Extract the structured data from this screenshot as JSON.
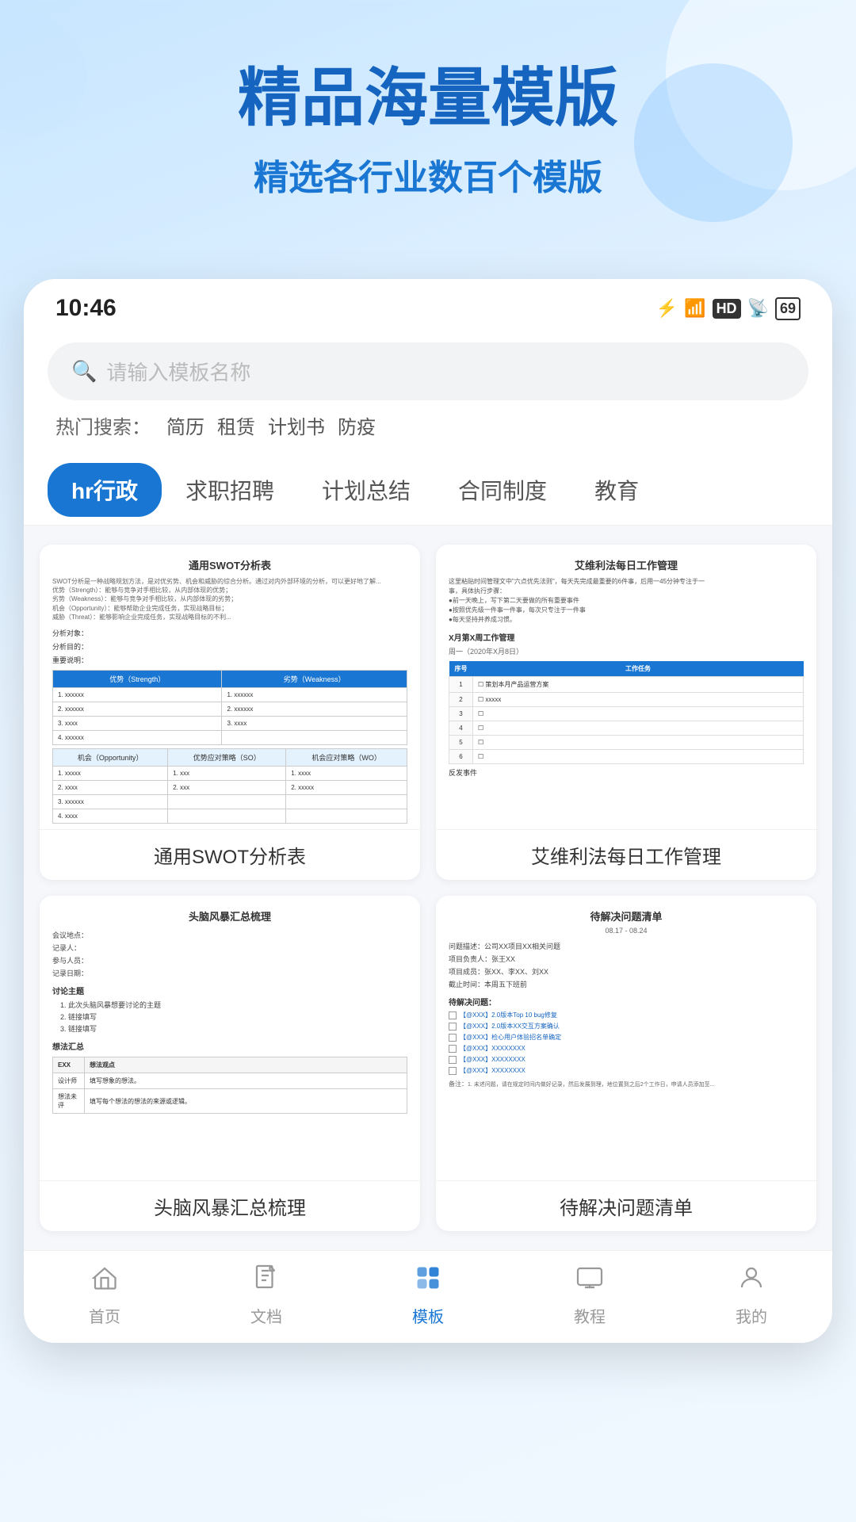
{
  "header": {
    "main_title": "精品海量模版",
    "sub_title": "精选各行业数百个模版"
  },
  "status_bar": {
    "time": "10:46",
    "icons": [
      "bluetooth",
      "wifi",
      "hd",
      "signal",
      "battery"
    ],
    "battery_level": "69"
  },
  "search": {
    "placeholder": "请输入模板名称",
    "hot_label": "热门搜索：",
    "hot_tags": [
      "简历",
      "租赁",
      "计划书",
      "防疫"
    ]
  },
  "categories": [
    {
      "label": "hr行政",
      "active": true
    },
    {
      "label": "求职招聘",
      "active": false
    },
    {
      "label": "计划总结",
      "active": false
    },
    {
      "label": "合同制度",
      "active": false
    },
    {
      "label": "教育",
      "active": false
    }
  ],
  "templates": [
    {
      "name": "通用SWOT分析表",
      "type": "swot"
    },
    {
      "name": "艾维利法每日工作管理",
      "type": "aiweili"
    },
    {
      "name": "头脑风暴汇总梳理",
      "type": "brainstorm"
    },
    {
      "name": "待解决问题清单",
      "type": "todo"
    }
  ],
  "bottom_nav": [
    {
      "label": "首页",
      "icon": "🏠",
      "active": false
    },
    {
      "label": "文档",
      "icon": "📄",
      "active": false
    },
    {
      "label": "模板",
      "icon": "📦",
      "active": true
    },
    {
      "label": "教程",
      "icon": "🖼",
      "active": false
    },
    {
      "label": "我的",
      "icon": "👤",
      "active": false
    }
  ]
}
